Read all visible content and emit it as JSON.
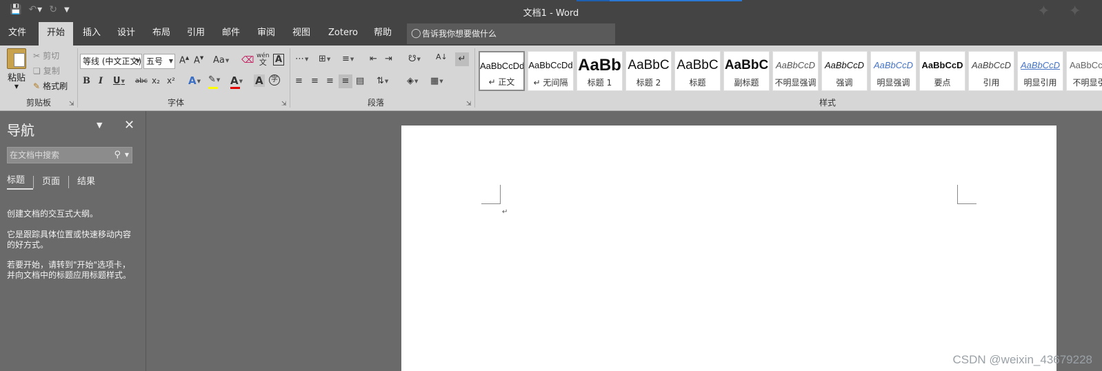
{
  "window": {
    "title": "文档1  -  Word"
  },
  "quick_access": {
    "save_icon": "save-icon",
    "undo_icon": "undo-icon",
    "redo_icon": "redo-icon",
    "customize_icon": "customize-qat-icon"
  },
  "menu": {
    "tabs": [
      "文件",
      "开始",
      "插入",
      "设计",
      "布局",
      "引用",
      "邮件",
      "审阅",
      "视图",
      "Zotero",
      "帮助"
    ],
    "active_tab": "开始",
    "tell_me": "告诉我你想要做什么"
  },
  "ribbon": {
    "clipboard": {
      "paste": "粘贴",
      "cut": "剪切",
      "copy": "复制",
      "format_painter": "格式刷",
      "label": "剪贴板"
    },
    "font": {
      "font_name": "等线 (中文正文)",
      "font_size": "五号",
      "change_case": "Aa",
      "label": "字体",
      "bold": "B",
      "italic": "I",
      "underline": "U",
      "strike": "abc",
      "subscript": "x₂",
      "superscript": "x²",
      "phonetic": "wén",
      "border_char": "A",
      "shade_char": "A",
      "enclose_char": "字"
    },
    "paragraph": {
      "label": "段落"
    },
    "styles": {
      "label": "样式",
      "items": [
        {
          "sample": "AaBbCcDd",
          "name": "正文"
        },
        {
          "sample": "AaBbCcDd",
          "name": "无间隔"
        },
        {
          "sample": "AaBb",
          "name": "标题 1"
        },
        {
          "sample": "AaBbC",
          "name": "标题 2"
        },
        {
          "sample": "AaBbC",
          "name": "标题"
        },
        {
          "sample": "AaBbC",
          "name": "副标题"
        },
        {
          "sample": "AaBbCcD",
          "name": "不明显强调"
        },
        {
          "sample": "AaBbCcD",
          "name": "强调"
        },
        {
          "sample": "AaBbCcD",
          "name": "明显强调"
        },
        {
          "sample": "AaBbCcD",
          "name": "要点"
        },
        {
          "sample": "AaBbCcD",
          "name": "引用"
        },
        {
          "sample": "AaBbCcD",
          "name": "明显引用"
        },
        {
          "sample": "AaBbCcD",
          "name": "不明显引"
        }
      ]
    }
  },
  "navigation": {
    "title": "导航",
    "search_placeholder": "在文档中搜索",
    "tabs": [
      "标题",
      "页面",
      "结果"
    ],
    "active_tab": "标题",
    "messages": [
      "创建文档的交互式大纲。",
      "它是跟踪具体位置或快速移动内容的好方式。",
      "若要开始，请转到\"开始\"选项卡，并向文档中的标题应用标题样式。"
    ]
  },
  "watermark": "CSDN @weixin_43679228",
  "colors": {
    "title_bar": "#444444",
    "ribbon": "#d6d6d6",
    "workspace": "#6a6a6a",
    "page": "#ffffff",
    "accent": "#2b78d4",
    "highlight_yellow": "#ffff00",
    "font_color_red": "#e00000"
  }
}
